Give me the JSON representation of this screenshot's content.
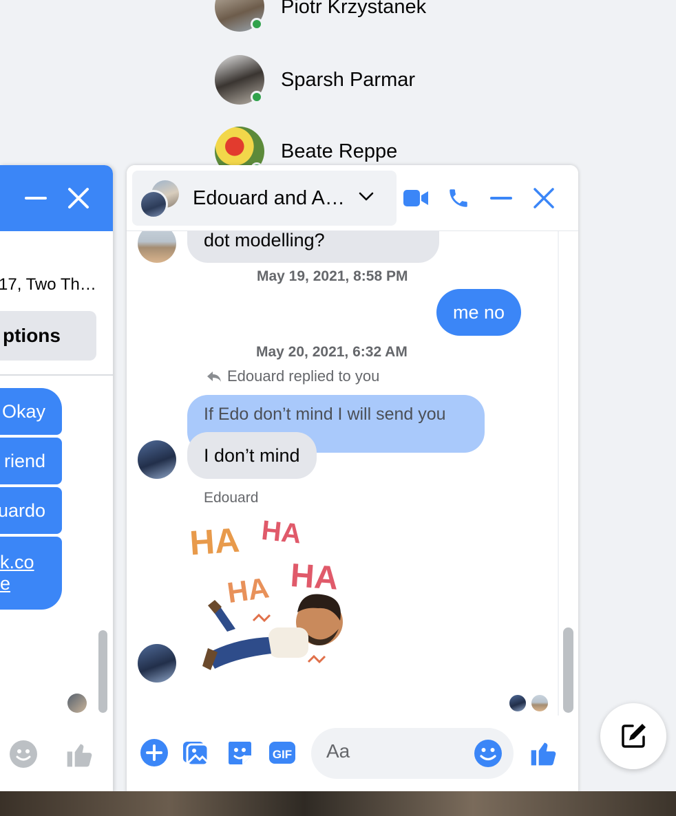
{
  "contacts": [
    {
      "name": "Piotr Krzystanek",
      "online": true
    },
    {
      "name": "Sparsh Parmar",
      "online": true
    },
    {
      "name": "Beate Reppe",
      "online": true
    }
  ],
  "left_chat": {
    "subtitle": "17, Two Th…",
    "options_label": "ptions",
    "messages": [
      "Okay",
      "riend",
      "uardo",
      "k.co",
      "e"
    ]
  },
  "chat": {
    "title": "Edouard and A…",
    "messages": {
      "partial_top": "dot modelling?",
      "ts1": "May 19, 2021, 8:58 PM",
      "me_no": "me no",
      "ts2": "May 20, 2021, 6:32 AM",
      "replied_label": "Edouard replied to you",
      "quoted": "If Edo don’t mind I will send you",
      "reply": "I don’t mind",
      "sender": "Edouard",
      "sticker_words": [
        "HA",
        "HA",
        "HA",
        "HA"
      ]
    },
    "composer": {
      "placeholder": "Aa"
    }
  },
  "colors": {
    "accent": "#3b86f7",
    "bubble_gray": "#e4e6eb",
    "quoted_blue": "#a9c9fb",
    "online": "#31a24c"
  },
  "icons": [
    "video-camera-icon",
    "phone-icon",
    "minimize-icon",
    "close-icon",
    "chevron-down-icon",
    "plus-icon",
    "image-icon",
    "sticker-icon",
    "gif-icon",
    "emoji-icon",
    "thumbs-up-icon",
    "compose-icon",
    "reply-arrow-icon"
  ]
}
